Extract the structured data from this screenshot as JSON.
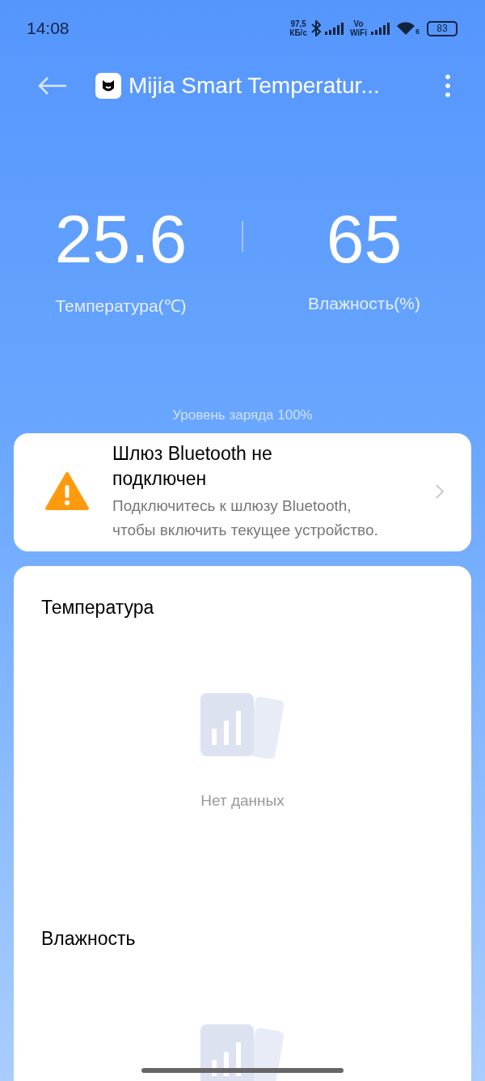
{
  "status_bar": {
    "time": "14:08",
    "speed_value": "97,5",
    "speed_unit": "КБ/с",
    "volte_top": "Vo",
    "volte_bottom": "WiFi",
    "wifi_badge": "6",
    "battery": "83"
  },
  "header": {
    "title": "Mijia Smart Temperatur..."
  },
  "readings": [
    {
      "value": "25.6",
      "label": "Температура(℃)"
    },
    {
      "value": "65",
      "label": "Влажность(%)"
    }
  ],
  "battery_level": "Уровень заряда 100%",
  "alert": {
    "title": "Шлюз Bluetooth не подключен",
    "message": "Подключитесь к шлюзу Bluetooth, чтобы включить текущее устройство."
  },
  "charts": [
    {
      "title": "Температура",
      "empty_text": "Нет данных"
    },
    {
      "title": "Влажность"
    }
  ]
}
